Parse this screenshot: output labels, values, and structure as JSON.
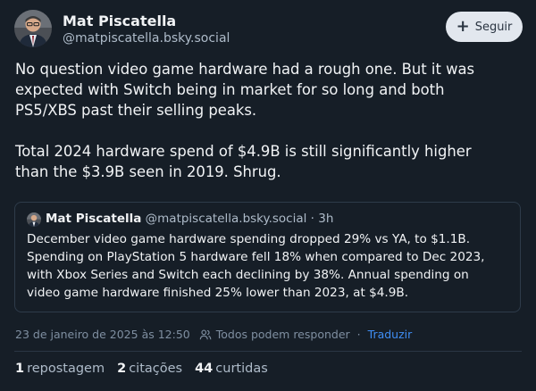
{
  "author": {
    "name": "Mat Piscatella",
    "handle": "@matpiscatella.bsky.social"
  },
  "follow": {
    "icon": "plus-icon",
    "label": "Seguir"
  },
  "post": {
    "paragraph1": "No question video game hardware had a rough one. But it was\nexpected with Switch being in market for so long and both\nPS5/XBS past their selling peaks.",
    "paragraph2": "Total 2024 hardware spend of $4.9B is still significantly higher\nthan the $3.9B seen in 2019. Shrug."
  },
  "quote": {
    "name": "Mat Piscatella",
    "handle": "@matpiscatella.bsky.social",
    "separator": "·",
    "time": "3h",
    "text": "December video game hardware spending dropped 29% vs YA, to $1.1B.\nSpending on PlayStation 5 hardware fell 18% when compared to Dec 2023,\nwith Xbox Series and Switch each declining by 38%. Annual spending on\nvideo game hardware finished 25% lower than 2023, at $4.9B."
  },
  "meta": {
    "timestamp": "23 de janeiro de 2025 às 12:50",
    "audience_icon": "people-icon",
    "audience": "Todos podem responder",
    "separator": "·",
    "translate": "Traduzir"
  },
  "stats": {
    "reposts_count": "1",
    "reposts_label": "repostagem",
    "quotes_count": "2",
    "quotes_label": "citações",
    "likes_count": "44",
    "likes_label": "curtidas"
  },
  "colors": {
    "background": "#161e27",
    "link": "#3f8ef5",
    "follow_button": "#e2e7ee"
  }
}
